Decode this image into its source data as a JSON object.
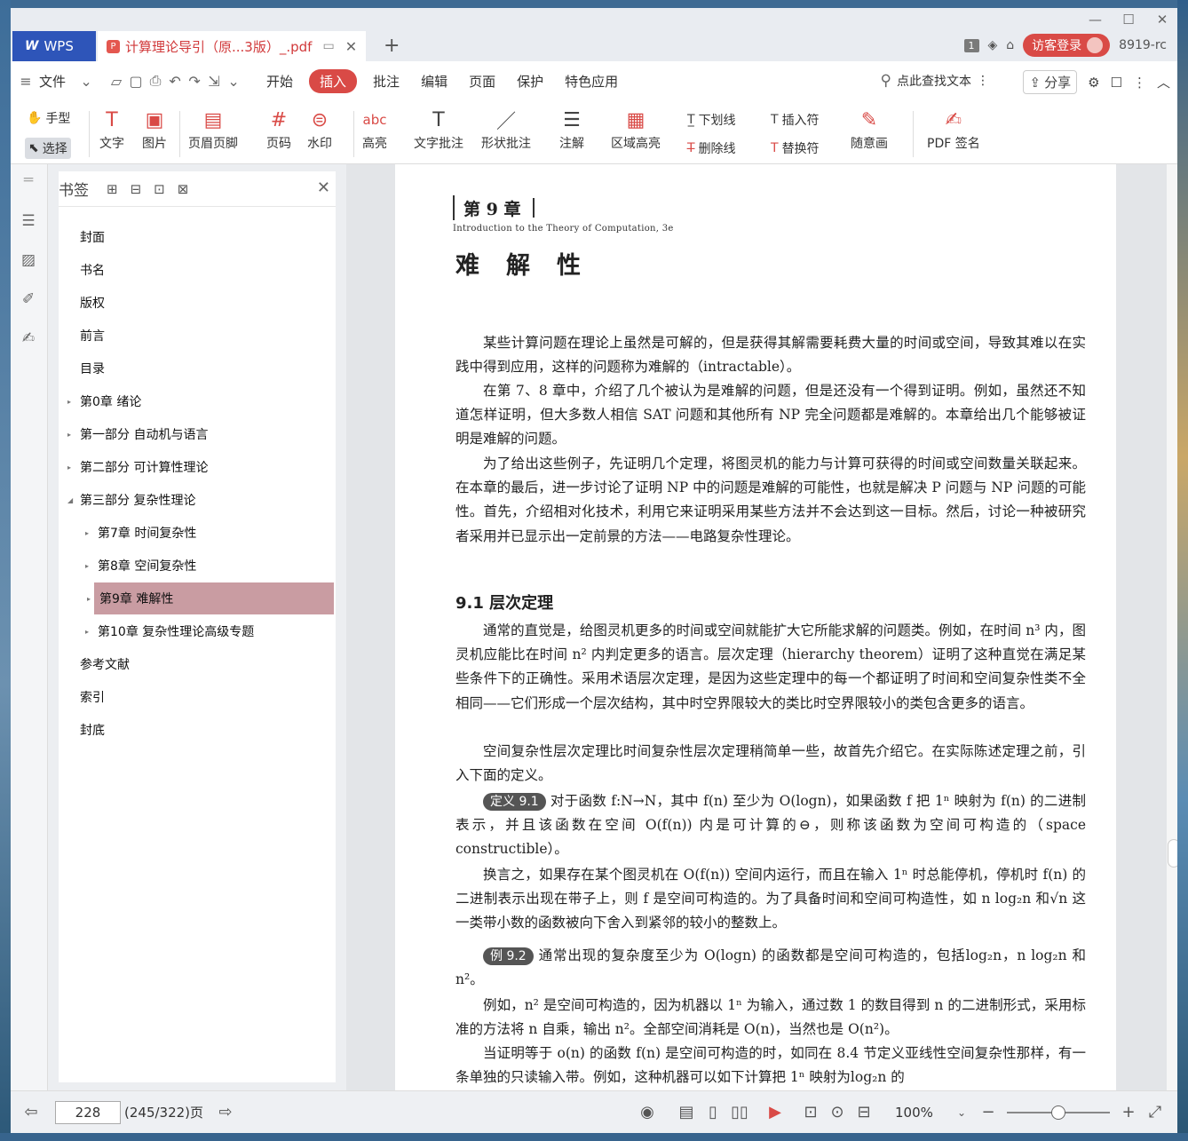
{
  "app": {
    "brand": "WPS",
    "tab_title": "计算理论导引（原...3版）_.pdf",
    "new_tab": "+"
  },
  "window": {
    "page_badge": "1",
    "login_label": "访客登录",
    "user_id": "8919-rc"
  },
  "menu": {
    "file": "文件",
    "tabs": [
      "开始",
      "插入",
      "批注",
      "编辑",
      "页面",
      "保护",
      "特色应用"
    ],
    "active_tab": "插入",
    "search_label": "点此查找文本",
    "share_label": "分享"
  },
  "ribbon": {
    "hand": "手型",
    "select": "选择",
    "text": "文字",
    "image": "图片",
    "header_footer": "页眉页脚",
    "page_num": "页码",
    "watermark": "水印",
    "highlight": "高亮",
    "text_note": "文字批注",
    "shape_note": "形状批注",
    "comment": "注解",
    "area_highlight": "区域高亮",
    "underline": "下划线",
    "strikethrough": "删除线",
    "insert_char": "插入符",
    "replace_char": "替换符",
    "freehand": "随意画",
    "pdf_sign": "PDF 签名"
  },
  "sidebar": {
    "title": "书签",
    "items": [
      {
        "label": "封面",
        "level": 0,
        "expandable": false
      },
      {
        "label": "书名",
        "level": 0,
        "expandable": false
      },
      {
        "label": "版权",
        "level": 0,
        "expandable": false
      },
      {
        "label": "前言",
        "level": 0,
        "expandable": false
      },
      {
        "label": "目录",
        "level": 0,
        "expandable": false
      },
      {
        "label": "第0章  绪论",
        "level": 0,
        "expandable": true
      },
      {
        "label": "第一部分  自动机与语言",
        "level": 0,
        "expandable": true
      },
      {
        "label": "第二部分  可计算性理论",
        "level": 0,
        "expandable": true
      },
      {
        "label": "第三部分  复杂性理论",
        "level": 0,
        "expandable": true,
        "expanded": true
      },
      {
        "label": "第7章  时间复杂性",
        "level": 1,
        "expandable": true
      },
      {
        "label": "第8章  空间复杂性",
        "level": 1,
        "expandable": true
      },
      {
        "label": "第9章  难解性",
        "level": 1,
        "expandable": true,
        "selected": true
      },
      {
        "label": "第10章  复杂性理论高级专题",
        "level": 1,
        "expandable": true
      },
      {
        "label": "参考文献",
        "level": 0,
        "expandable": false
      },
      {
        "label": "索引",
        "level": 0,
        "expandable": false
      },
      {
        "label": "封底",
        "level": 0,
        "expandable": false
      }
    ]
  },
  "document": {
    "chapter_num": "第 9 章",
    "chapter_sub": "Introduction to the Theory of Computation, 3e",
    "chapter_title": "难解性",
    "p1": "某些计算问题在理论上虽然是可解的，但是获得其解需要耗费大量的时间或空间，导致其难以在实践中得到应用，这样的问题称为难解的（intractable）。",
    "p2": "在第 7、8 章中，介绍了几个被认为是难解的问题，但是还没有一个得到证明。例如，虽然还不知道怎样证明，但大多数人相信 SAT 问题和其他所有 NP 完全问题都是难解的。本章给出几个能够被证明是难解的问题。",
    "p3": "为了给出这些例子，先证明几个定理，将图灵机的能力与计算可获得的时间或空间数量关联起来。在本章的最后，进一步讨论了证明 NP 中的问题是难解的可能性，也就是解决 P 问题与 NP 问题的可能性。首先，介绍相对化技术，利用它来证明采用某些方法并不会达到这一目标。然后，讨论一种被研究者采用并已显示出一定前景的方法——电路复杂性理论。",
    "section": "9.1   层次定理",
    "p4": "通常的直觉是，给图灵机更多的时间或空间就能扩大它所能求解的问题类。例如，在时间 n³ 内，图灵机应能比在时间 n² 内判定更多的语言。层次定理（hierarchy theorem）证明了这种直觉在满足某些条件下的正确性。采用术语层次定理，是因为这些定理中的每一个都证明了时间和空间复杂性类不全相同——它们形成一个层次结构，其中时空界限较大的类比时空界限较小的类包含更多的语言。",
    "p5": "空间复杂性层次定理比时间复杂性层次定理稍简单一些，故首先介绍它。在实际陈述定理之前，引入下面的定义。",
    "def_tag": "定义 9.1",
    "def_text": "对于函数 f:N→N，其中 f(n) 至少为 O(logn)，如果函数 f 把 1ⁿ 映射为 f(n) 的二进制表示，并且该函数在空间 O(f(n)) 内是可计算的⊖，则称该函数为空间可构造的（space constructible）。",
    "p6": "换言之，如果存在某个图灵机在 O(f(n)) 空间内运行，而且在输入 1ⁿ 时总能停机，停机时 f(n) 的二进制表示出现在带子上，则 f 是空间可构造的。为了具备时间和空间可构造性，如 n log₂n 和√n 这一类带小数的函数被向下舍入到紧邻的较小的整数上。",
    "ex_tag": "例 9.2",
    "ex_text": "通常出现的复杂度至少为 O(logn) 的函数都是空间可构造的，包括log₂n，n log₂n 和 n²。",
    "p7": "例如，n² 是空间可构造的，因为机器以 1ⁿ 为输入，通过数 1 的数目得到 n 的二进制形式，采用标准的方法将 n 自乘，输出 n²。全部空间消耗是 O(n)，当然也是 O(n²)。",
    "p8": "当证明等于 o(n) 的函数 f(n) 是空间可构造的时，如同在 8.4 节定义亚线性空间复杂性那样，有一条单独的只读输入带。例如，这种机器可以如下计算把 1ⁿ 映射为log₂n 的"
  },
  "status": {
    "page_input": "228",
    "page_info": "(245/322)页",
    "zoom": "100%"
  }
}
